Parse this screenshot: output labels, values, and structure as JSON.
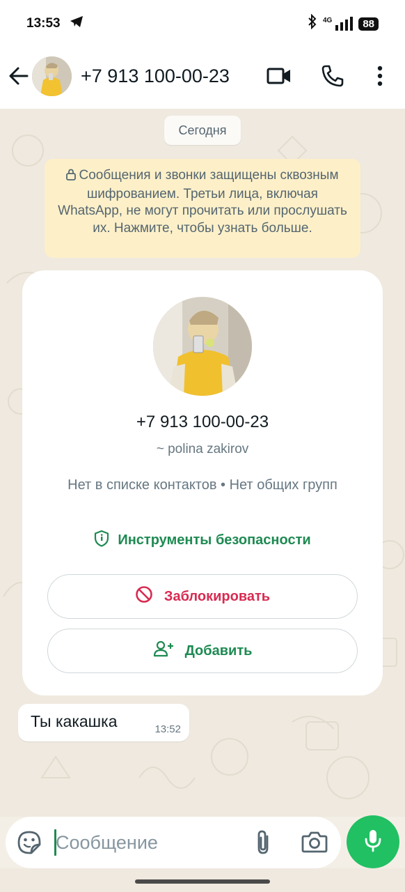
{
  "status_bar": {
    "time": "13:53",
    "network": "4G",
    "battery": "88"
  },
  "header": {
    "title": "+7 913 100-00-23",
    "icons": [
      "arrow-left-icon",
      "video-call-icon",
      "phone-call-icon",
      "more-vert-icon"
    ]
  },
  "chat": {
    "date_chip": "Сегодня",
    "encryption_notice": "Сообщения и звонки защищены сквозным шифрованием. Третьи лица, включая WhatsApp, не могут прочитать или прослушать их. Нажмите, чтобы узнать больше.",
    "profile_card": {
      "phone": "+7 913 100-00-23",
      "name": "~ polina zakirov",
      "info": "Нет в списке контактов • Нет общих групп",
      "safety_link": "Инструменты безопасности",
      "block_label": "Заблокировать",
      "add_label": "Добавить"
    },
    "messages": [
      {
        "text": "Ты какашка",
        "time": "13:52",
        "direction": "incoming"
      }
    ]
  },
  "composer": {
    "placeholder": "Сообщение",
    "value": ""
  },
  "colors": {
    "accent_green": "#1e8a52",
    "mic_green": "#21c063",
    "block_red": "#d72b51",
    "notice_bg": "#fdf0c9",
    "chat_bg": "#efe9df"
  }
}
